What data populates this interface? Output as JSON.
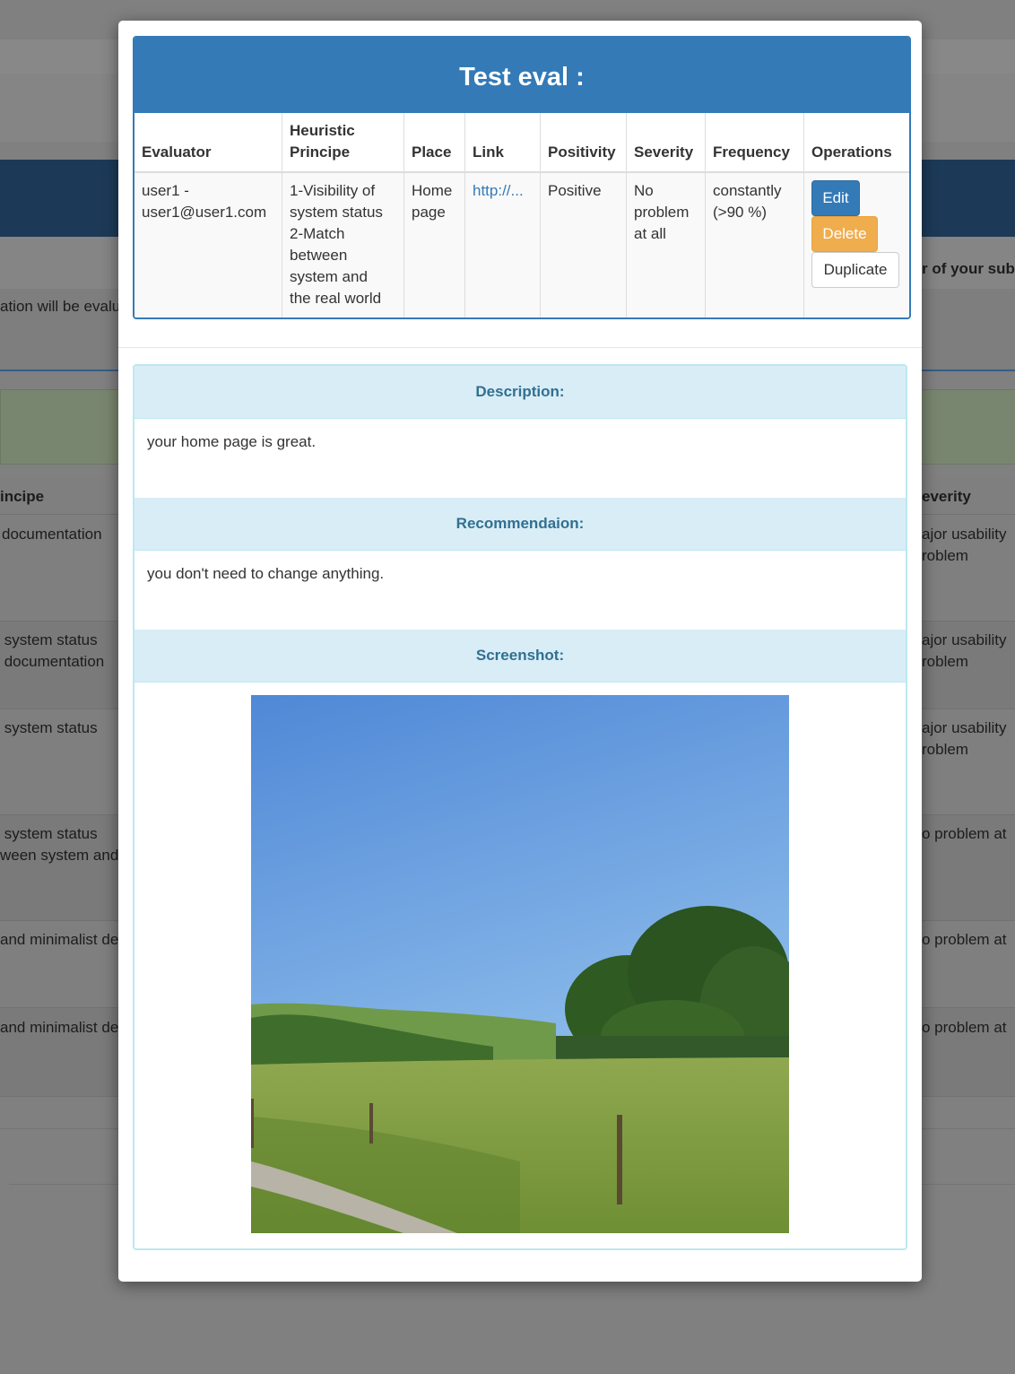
{
  "background": {
    "texts": {
      "right_header": "r of your sub",
      "left_row": "ation will be evalu",
      "col_principle": "incipe",
      "col_severity": "everity",
      "r1_left": "documentation",
      "r1_right_1": "ajor usability",
      "r1_right_2": "roblem",
      "r2_left_1": " system status",
      "r2_left_2": " documentation",
      "r2_right_1": "ajor usability",
      "r2_right_2": "roblem",
      "r3_left": " system status",
      "r3_right_1": "ajor usability",
      "r3_right_2": "roblem",
      "r4_left_1": " system status",
      "r4_left_2": "ween system and",
      "r4_right": "o problem at",
      "r5_left": "and minimalist de",
      "r5_right": "o problem at",
      "r6_left": "and minimalist de",
      "r6_right": "o problem at"
    }
  },
  "modal": {
    "title": "Test eval :",
    "columns": {
      "evaluator": "Evaluator",
      "heuristic_1": "Heuristic",
      "heuristic_2": "Principe",
      "place": "Place",
      "link": "Link",
      "positivity": "Positivity",
      "severity": "Severity",
      "frequency": "Frequency",
      "operations": "Operations"
    },
    "row": {
      "evaluator_1": "user1 -",
      "evaluator_2": "user1@user1.com",
      "principle_1": "1-Visibility of",
      "principle_2": "system status",
      "principle_3": "2-Match",
      "principle_4": "between",
      "principle_5": "system and",
      "principle_6": "the real world",
      "place_1": "Home",
      "place_2": "page",
      "link": "http://...",
      "positivity": "Positive",
      "severity_1": "No",
      "severity_2": "problem",
      "severity_3": "at all",
      "frequency_1": "constantly",
      "frequency_2": "(>90 %)"
    },
    "buttons": {
      "edit": "Edit",
      "delete": "Delete",
      "duplicate": "Duplicate"
    },
    "details": {
      "description_heading": "Description:",
      "description_text": "your home page is great.",
      "recommendation_heading": "Recommendaion:",
      "recommendation_text": "you don't need to change anything.",
      "screenshot_heading": "Screenshot:"
    }
  },
  "colors": {
    "primary": "#337ab7",
    "warning": "#f0ad4e",
    "info_bg": "#d9edf7",
    "info_text": "#31708f",
    "overlay": "#808080"
  }
}
